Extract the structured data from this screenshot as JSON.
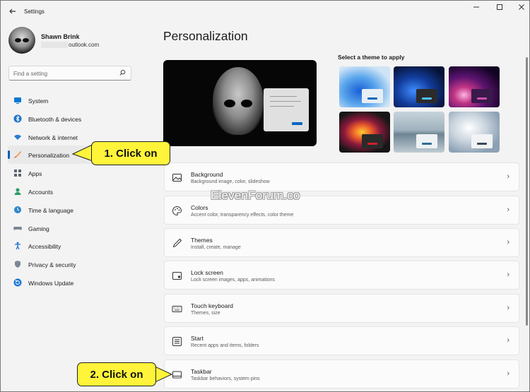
{
  "window": {
    "app_title": "Settings",
    "back_icon": "back-arrow-icon",
    "controls": [
      "minimize-icon",
      "maximize-icon",
      "close-icon"
    ]
  },
  "profile": {
    "name": "Shawn Brink",
    "email_suffix": "outlook.com"
  },
  "search": {
    "placeholder": "Find a setting"
  },
  "sidebar": {
    "items": [
      {
        "label": "System",
        "icon": "system-icon",
        "active": false
      },
      {
        "label": "Bluetooth & devices",
        "icon": "bluetooth-icon",
        "active": false
      },
      {
        "label": "Network & internet",
        "icon": "wifi-icon",
        "active": false
      },
      {
        "label": "Personalization",
        "icon": "brush-icon",
        "active": true
      },
      {
        "label": "Apps",
        "icon": "apps-icon",
        "active": false
      },
      {
        "label": "Accounts",
        "icon": "person-icon",
        "active": false
      },
      {
        "label": "Time & language",
        "icon": "globe-clock-icon",
        "active": false
      },
      {
        "label": "Gaming",
        "icon": "gamepad-icon",
        "active": false
      },
      {
        "label": "Accessibility",
        "icon": "accessibility-icon",
        "active": false
      },
      {
        "label": "Privacy & security",
        "icon": "shield-icon",
        "active": false
      },
      {
        "label": "Windows Update",
        "icon": "update-icon",
        "active": false
      }
    ]
  },
  "main": {
    "title": "Personalization",
    "themes_label": "Select a theme to apply",
    "watermark": "ElevenForum.co",
    "cards": [
      {
        "title": "Background",
        "subtitle": "Background image, color, slideshow",
        "icon": "image-icon"
      },
      {
        "title": "Colors",
        "subtitle": "Accent color, transparency effects, color theme",
        "icon": "palette-icon"
      },
      {
        "title": "Themes",
        "subtitle": "Install, create, manage",
        "icon": "pen-icon"
      },
      {
        "title": "Lock screen",
        "subtitle": "Lock screen images, apps, animations",
        "icon": "lock-screen-icon"
      },
      {
        "title": "Touch keyboard",
        "subtitle": "Themes, size",
        "icon": "keyboard-icon"
      },
      {
        "title": "Start",
        "subtitle": "Recent apps and items, folders",
        "icon": "start-icon"
      },
      {
        "title": "Taskbar",
        "subtitle": "Taskbar behaviors, system pins",
        "icon": "taskbar-icon"
      }
    ]
  },
  "callouts": {
    "step1": "1. Click on",
    "step2": "2. Click on"
  },
  "colors": {
    "accent": "#005fb8",
    "callout": "#fff43a"
  }
}
